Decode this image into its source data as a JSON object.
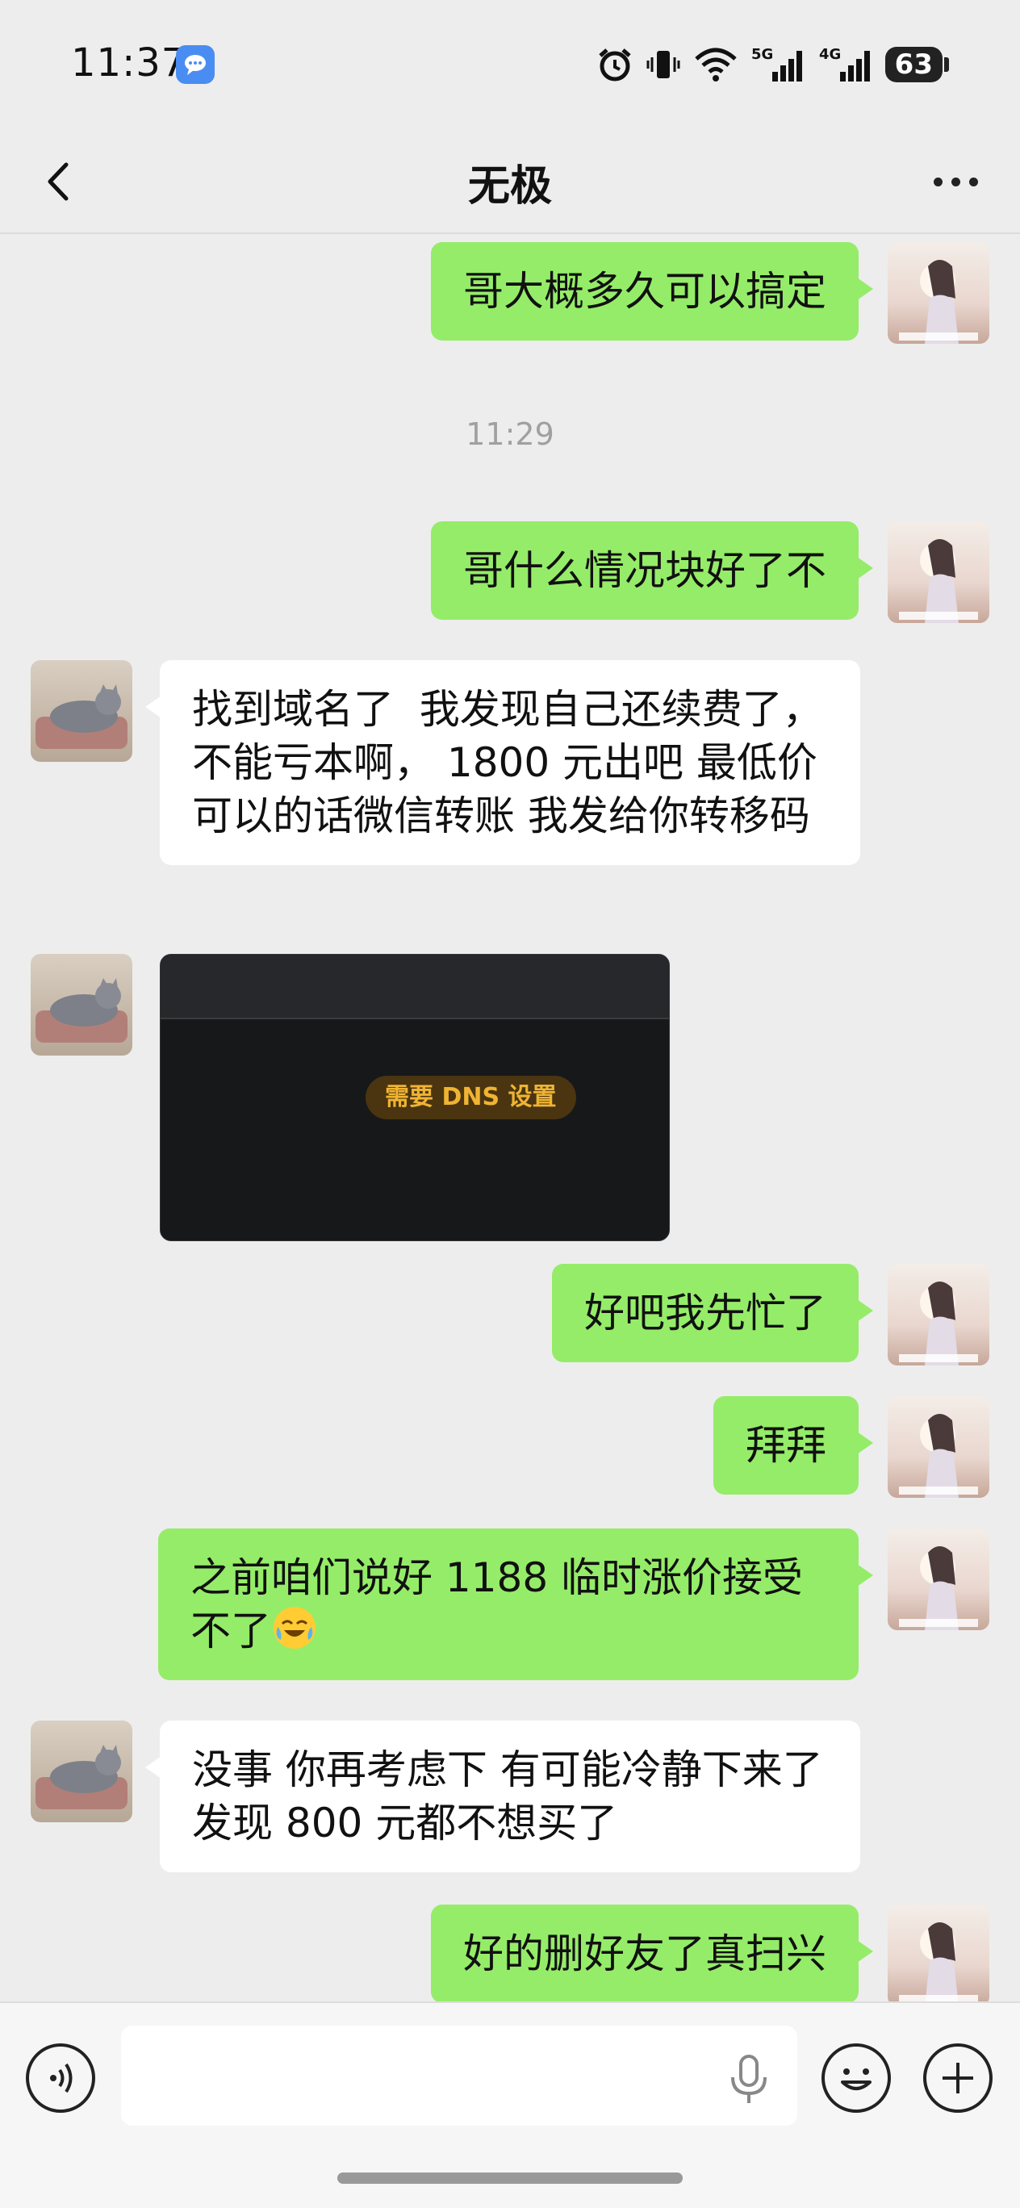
{
  "status_bar": {
    "time": "11:37",
    "network_1": "5G",
    "network_2": "4G",
    "battery": "63"
  },
  "header": {
    "title": "无极"
  },
  "messages": [
    {
      "side": "me",
      "text": "哥大概多久可以搞定"
    },
    {
      "type": "time",
      "text": "11:29"
    },
    {
      "side": "me",
      "text": "哥什么情况块好了不"
    },
    {
      "side": "them",
      "text": "找到域名了  我发现自己还续费了，不能亏本啊， 1800 元出吧 最低价  可以的话微信转账 我发给你转移码"
    },
    {
      "side": "them",
      "type": "image",
      "caption": "需要 DNS 设置"
    },
    {
      "side": "me",
      "text": "好吧我先忙了"
    },
    {
      "side": "me",
      "text": "拜拜"
    },
    {
      "side": "me",
      "text": "之前咱们说好 1188 临时涨价接受不了",
      "emoji": "face-with-tears-of-joy"
    },
    {
      "side": "them",
      "text": "没事 你再考虑下 有可能冷静下来了发现 800 元都不想买了"
    },
    {
      "side": "me",
      "text": "好的删好友了真扫兴"
    }
  ],
  "colors": {
    "my_bubble": "#95ec69",
    "their_bubble": "#ffffff",
    "background": "#ededed"
  }
}
